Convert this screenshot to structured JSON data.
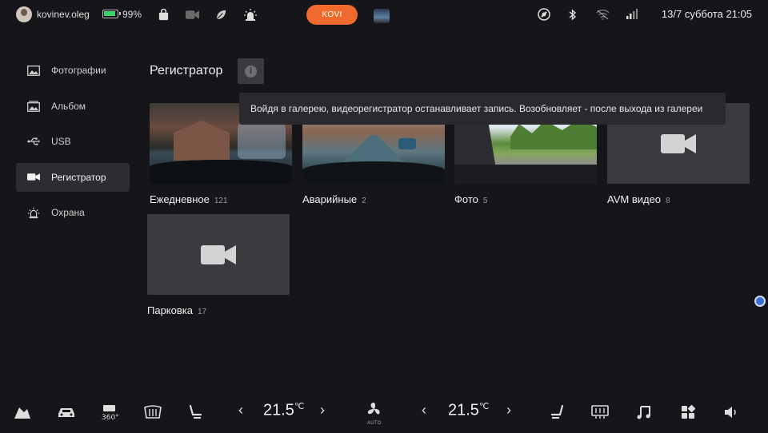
{
  "status_bar": {
    "username": "kovinev.oleg",
    "battery_percent": "99%",
    "battery_color": "#39d36a",
    "center_button_label": "KOVI",
    "center_button_color": "#f06a2e",
    "datetime": "13/7 суббота 21:05",
    "icons": [
      "battery-icon",
      "bag-icon",
      "camera-icon",
      "leaf-icon",
      "alarm-icon",
      "signal-icon",
      "bluetooth-icon",
      "wifi-icon",
      "cellular-icon"
    ]
  },
  "sidebar": {
    "items": [
      {
        "label": "Фотографии",
        "icon": "photo-icon",
        "active": false
      },
      {
        "label": "Альбом",
        "icon": "album-icon",
        "active": false
      },
      {
        "label": "USB",
        "icon": "usb-icon",
        "active": false
      },
      {
        "label": "Регистратор",
        "icon": "dashcam-icon",
        "active": true
      },
      {
        "label": "Охрана",
        "icon": "alarm-icon",
        "active": false
      }
    ]
  },
  "main": {
    "title": "Регистратор",
    "tooltip": "Войдя в галерею, видеорегистратор останавливает запись. Возобновляет - после выхода из галереи",
    "albums": [
      {
        "label": "Ежедневное",
        "count": "121",
        "thumbnail": "image"
      },
      {
        "label": "Аварийные",
        "count": "2",
        "thumbnail": "image"
      },
      {
        "label": "Фото",
        "count": "5",
        "thumbnail": "image"
      },
      {
        "label": "AVM видео",
        "count": "8",
        "thumbnail": "video-placeholder"
      },
      {
        "label": "Парковка",
        "count": "17",
        "thumbnail": "video-placeholder"
      }
    ]
  },
  "bottom_bar": {
    "left_temp": "21.5",
    "right_temp": "21.5",
    "temp_unit": "℃",
    "fan_mode": "AUTO",
    "left_arrow": "‹",
    "right_arrow": "›"
  }
}
